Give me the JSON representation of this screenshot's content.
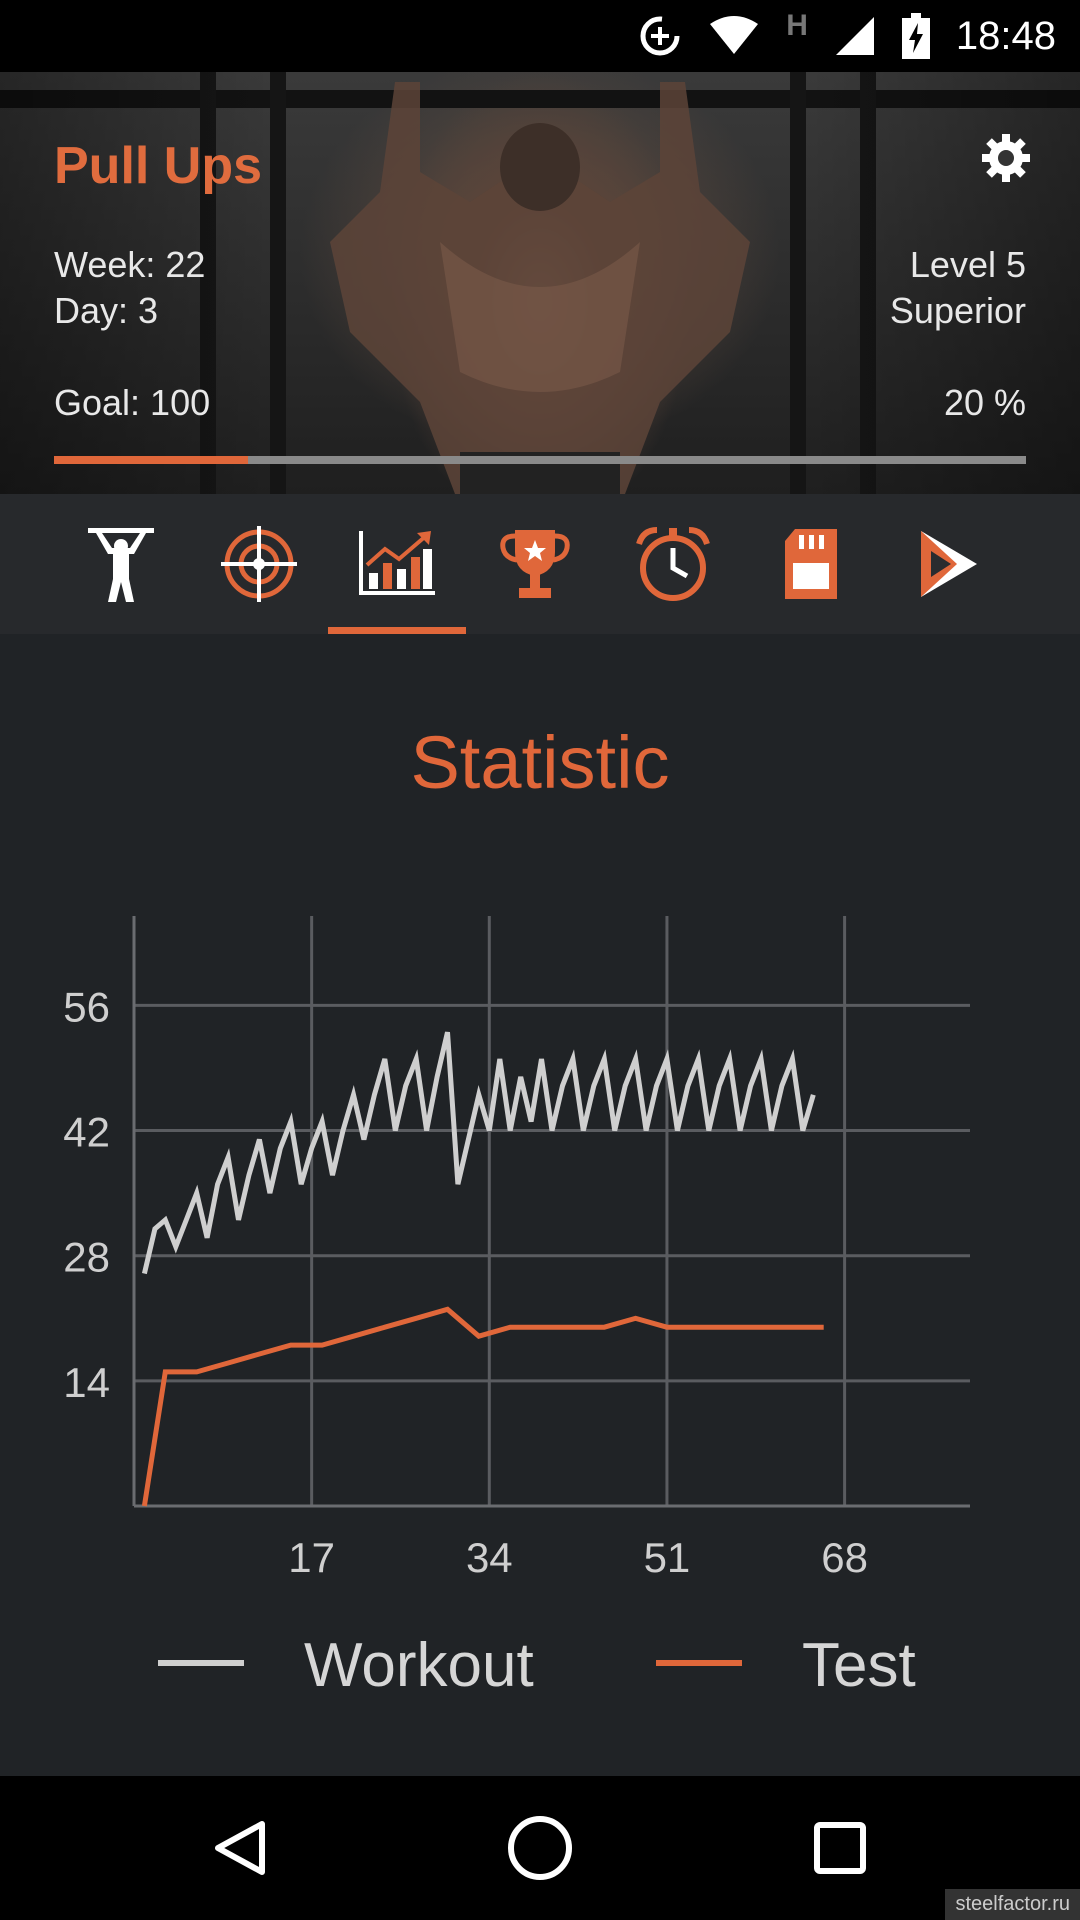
{
  "status_bar": {
    "time": "18:48",
    "network_letter": "H"
  },
  "header": {
    "title": "Pull Ups",
    "week": "Week: 22",
    "day": "Day: 3",
    "level": "Level 5",
    "rank": "Superior",
    "goal": "Goal: 100",
    "percent_label": "20 %",
    "progress_fraction": 0.2,
    "settings_icon": "gear-icon"
  },
  "tabs": [
    {
      "icon": "athlete-icon",
      "active": false
    },
    {
      "icon": "target-icon",
      "active": false
    },
    {
      "icon": "statistics-chart-icon",
      "active": true
    },
    {
      "icon": "trophy-icon",
      "active": false
    },
    {
      "icon": "alarm-clock-icon",
      "active": false
    },
    {
      "icon": "sd-card-icon",
      "active": false
    },
    {
      "icon": "play-store-icon",
      "active": false
    }
  ],
  "statistic": {
    "title": "Statistic",
    "legend": {
      "workout": "Workout",
      "test": "Test"
    }
  },
  "colors": {
    "accent": "#e0673a",
    "workout_line": "#cfcfcf",
    "background": "#202326"
  },
  "chart_data": {
    "type": "line",
    "xlim": [
      0,
      80
    ],
    "ylim": [
      0,
      66
    ],
    "x_ticks": [
      17,
      34,
      51,
      68
    ],
    "y_ticks": [
      14,
      28,
      42,
      56
    ],
    "grid": true,
    "legend_position": "bottom",
    "series": [
      {
        "name": "Workout",
        "color": "#cfcfcf",
        "points": [
          [
            1,
            26
          ],
          [
            2,
            31
          ],
          [
            3,
            32
          ],
          [
            4,
            29
          ],
          [
            5,
            32
          ],
          [
            6,
            35
          ],
          [
            7,
            30
          ],
          [
            8,
            36
          ],
          [
            9,
            39
          ],
          [
            10,
            32
          ],
          [
            11,
            37
          ],
          [
            12,
            41
          ],
          [
            13,
            35
          ],
          [
            14,
            40
          ],
          [
            15,
            43
          ],
          [
            16,
            36
          ],
          [
            17,
            40
          ],
          [
            18,
            43
          ],
          [
            19,
            37
          ],
          [
            20,
            42
          ],
          [
            21,
            46
          ],
          [
            22,
            41
          ],
          [
            23,
            46
          ],
          [
            24,
            50
          ],
          [
            25,
            42
          ],
          [
            26,
            47
          ],
          [
            27,
            50
          ],
          [
            28,
            42
          ],
          [
            29,
            48
          ],
          [
            30,
            53
          ],
          [
            31,
            36
          ],
          [
            32,
            41
          ],
          [
            33,
            46
          ],
          [
            34,
            42
          ],
          [
            35,
            50
          ],
          [
            36,
            42
          ],
          [
            37,
            48
          ],
          [
            38,
            43
          ],
          [
            39,
            50
          ],
          [
            40,
            42
          ],
          [
            41,
            47
          ],
          [
            42,
            50
          ],
          [
            43,
            42
          ],
          [
            44,
            47
          ],
          [
            45,
            50
          ],
          [
            46,
            42
          ],
          [
            47,
            47
          ],
          [
            48,
            50
          ],
          [
            49,
            42
          ],
          [
            50,
            47
          ],
          [
            51,
            50
          ],
          [
            52,
            42
          ],
          [
            53,
            47
          ],
          [
            54,
            50
          ],
          [
            55,
            42
          ],
          [
            56,
            47
          ],
          [
            57,
            50
          ],
          [
            58,
            42
          ],
          [
            59,
            47
          ],
          [
            60,
            50
          ],
          [
            61,
            42
          ],
          [
            62,
            47
          ],
          [
            63,
            50
          ],
          [
            64,
            42
          ],
          [
            65,
            46
          ]
        ]
      },
      {
        "name": "Test",
        "color": "#e0673a",
        "points": [
          [
            1,
            0
          ],
          [
            3,
            15
          ],
          [
            6,
            15
          ],
          [
            9,
            16
          ],
          [
            12,
            17
          ],
          [
            15,
            18
          ],
          [
            18,
            18
          ],
          [
            21,
            19
          ],
          [
            24,
            20
          ],
          [
            27,
            21
          ],
          [
            30,
            22
          ],
          [
            33,
            19
          ],
          [
            36,
            20
          ],
          [
            39,
            20
          ],
          [
            42,
            20
          ],
          [
            45,
            20
          ],
          [
            48,
            21
          ],
          [
            51,
            20
          ],
          [
            54,
            20
          ],
          [
            57,
            20
          ],
          [
            60,
            20
          ],
          [
            63,
            20
          ],
          [
            66,
            20
          ]
        ]
      }
    ]
  }
}
